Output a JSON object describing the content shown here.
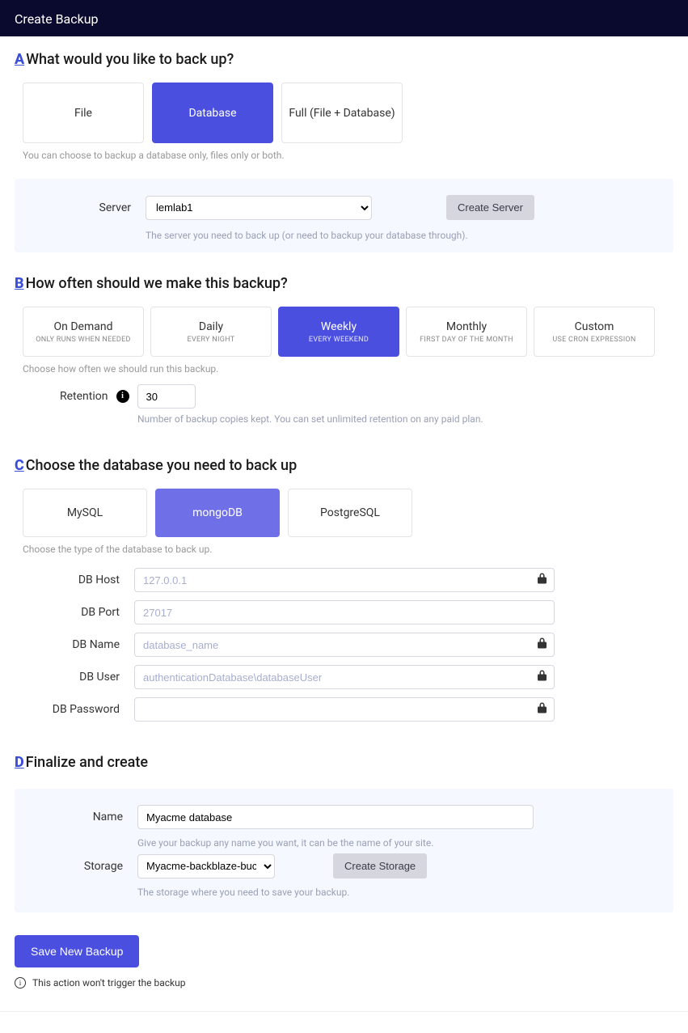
{
  "header": {
    "title": "Create Backup"
  },
  "stepA": {
    "letter": "A",
    "title": "What would you like to back up?",
    "options": [
      {
        "label": "File"
      },
      {
        "label": "Database"
      },
      {
        "label": "Full (File + Database)"
      }
    ],
    "help": "You can choose to backup a database only, files only or both.",
    "server_label": "Server",
    "server_value": "lemlab1",
    "create_server_btn": "Create Server",
    "server_help": "The server you need to back up (or need to backup your database through)."
  },
  "stepB": {
    "letter": "B",
    "title": "How often should we make this backup?",
    "options": [
      {
        "main": "On Demand",
        "sub": "ONLY RUNS WHEN NEEDED"
      },
      {
        "main": "Daily",
        "sub": "EVERY NIGHT"
      },
      {
        "main": "Weekly",
        "sub": "EVERY WEEKEND"
      },
      {
        "main": "Monthly",
        "sub": "FIRST DAY OF THE MONTH"
      },
      {
        "main": "Custom",
        "sub": "USE CRON EXPRESSION"
      }
    ],
    "help": "Choose how often we should run this backup.",
    "retention_label": "Retention",
    "retention_value": "30",
    "retention_help": "Number of backup copies kept. You can set unlimited retention on any paid plan."
  },
  "stepC": {
    "letter": "C",
    "title": "Choose the database you need to back up",
    "options": [
      {
        "label": "MySQL"
      },
      {
        "label": "mongoDB"
      },
      {
        "label": "PostgreSQL"
      }
    ],
    "help": "Choose the type of the database to back up.",
    "fields": {
      "host": {
        "label": "DB Host",
        "placeholder": "127.0.0.1",
        "locked": true
      },
      "port": {
        "label": "DB Port",
        "placeholder": "27017",
        "locked": false
      },
      "name": {
        "label": "DB Name",
        "placeholder": "database_name",
        "locked": true
      },
      "user": {
        "label": "DB User",
        "placeholder": "authenticationDatabase\\databaseUser",
        "locked": true
      },
      "password": {
        "label": "DB Password",
        "placeholder": "",
        "locked": true
      }
    }
  },
  "stepD": {
    "letter": "D",
    "title": "Finalize and create",
    "name_label": "Name",
    "name_value": "Myacme database",
    "name_help": "Give your backup any name you want, it can be the name of your site.",
    "storage_label": "Storage",
    "storage_value": "Myacme-backblaze-bucket",
    "create_storage_btn": "Create Storage",
    "storage_help": "The storage where you need to save your backup."
  },
  "actions": {
    "save_btn": "Save New Backup",
    "note": "This action won't trigger the backup"
  }
}
